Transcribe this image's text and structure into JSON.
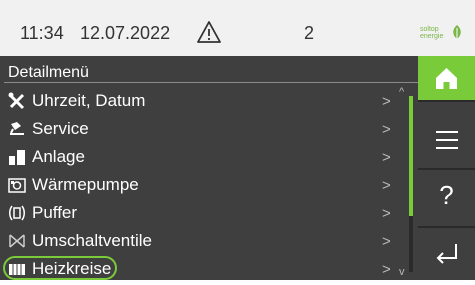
{
  "status_bar": {
    "time": "11:34",
    "date": "12.07.2022",
    "warning_icon": "warning-triangle-icon",
    "count": "2",
    "logo_text": "soltop energie"
  },
  "menu": {
    "title": "Detailmenü",
    "items": [
      {
        "label": "Uhrzeit, Datum",
        "icon": "tools-icon"
      },
      {
        "label": "Service",
        "icon": "service-icon"
      },
      {
        "label": "Anlage",
        "icon": "plant-icon"
      },
      {
        "label": "Wärmepumpe",
        "icon": "heat-pump-icon"
      },
      {
        "label": "Puffer",
        "icon": "buffer-icon"
      },
      {
        "label": "Umschaltventile",
        "icon": "valve-icon"
      },
      {
        "label": "Heizkreise",
        "icon": "radiator-icon",
        "selected": true
      }
    ],
    "arrow": ">"
  },
  "side_nav": {
    "home_icon": "home-icon",
    "menu_icon": "hamburger-menu-icon",
    "help_label": "?",
    "back_icon": "back-arrow-icon"
  },
  "colors": {
    "accent": "#7acb3a",
    "panel": "#3f3f3f",
    "status_bar": "#f1f1f1"
  }
}
